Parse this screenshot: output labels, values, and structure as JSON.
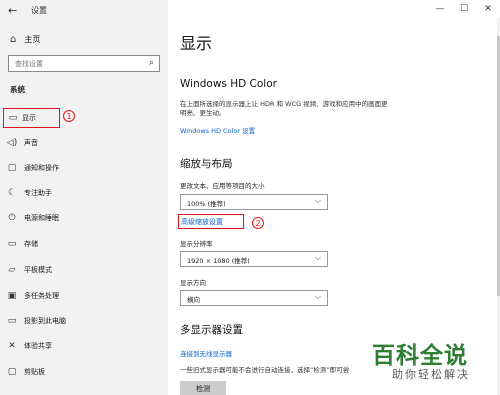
{
  "window": {
    "title": "设置",
    "back_icon": "←",
    "controls": [
      "—",
      "☐",
      "✕"
    ]
  },
  "sidebar": {
    "home": {
      "icon": "⌂",
      "label": "主页"
    },
    "search": {
      "placeholder": "查找设置",
      "icon": "⌕"
    },
    "section": "系统",
    "items": [
      {
        "icon": "▭",
        "label": "显示"
      },
      {
        "icon": "◁)",
        "label": "声音"
      },
      {
        "icon": "▢",
        "label": "通知和操作"
      },
      {
        "icon": "☾",
        "label": "专注助手"
      },
      {
        "icon": "⏻",
        "label": "电源和睡眠"
      },
      {
        "icon": "▭",
        "label": "存储"
      },
      {
        "icon": "▱",
        "label": "平板模式"
      },
      {
        "icon": "▣",
        "label": "多任务处理"
      },
      {
        "icon": "▭",
        "label": "投影到此电脑"
      },
      {
        "icon": "✕",
        "label": "体验共享"
      },
      {
        "icon": "▢",
        "label": "剪贴板"
      }
    ],
    "annotation_1": "1"
  },
  "main": {
    "page_title": "显示",
    "hd_color": {
      "heading": "Windows HD Color",
      "description_line1": "在上面所选择的显示器上让 HDR 和 WCG 视频、游戏和应用中的画面更",
      "description_line2": "明亮、更生动。",
      "link": "Windows HD Color 设置"
    },
    "scale_layout": {
      "heading": "缩放与布局",
      "scale_label": "更改文本、应用等项目的大小",
      "scale_value": "100% (推荐)",
      "advanced_link": "高级缩放设置",
      "resolution_label": "显示分辨率",
      "resolution_value": "1920 × 1080 (推荐)",
      "orientation_label": "显示方向",
      "orientation_value": "横向",
      "chevron": "⌵",
      "annotation_2": "2"
    },
    "multi_display": {
      "heading": "多显示器设置",
      "link": "连接到无线显示器",
      "description": "一些旧式显示器可能不会进行自动连接，选择“检测”即可尝",
      "detect_button": "检测"
    }
  },
  "watermark": {
    "main": "百科全说",
    "sub": "助你轻松解决"
  }
}
